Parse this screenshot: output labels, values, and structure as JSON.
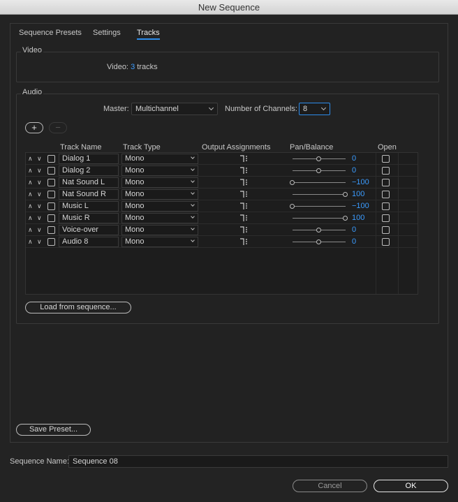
{
  "window": {
    "title": "New Sequence"
  },
  "tabs": [
    {
      "label": "Sequence Presets"
    },
    {
      "label": "Settings"
    },
    {
      "label": "Tracks"
    }
  ],
  "video": {
    "group_label": "Video",
    "label": "Video:",
    "count": "3",
    "unit": "tracks"
  },
  "audio": {
    "group_label": "Audio",
    "master_label": "Master:",
    "master_value": "Multichannel",
    "channels_label": "Number of Channels:",
    "channels_value": "8",
    "add_label": "+",
    "remove_label": "−",
    "columns": {
      "track_name": "Track Name",
      "track_type": "Track Type",
      "output": "Output Assignments",
      "pan": "Pan/Balance",
      "open": "Open"
    },
    "tracks": [
      {
        "name": "Dialog 1",
        "type": "Mono",
        "pan": "0",
        "pan_value": 0
      },
      {
        "name": "Dialog 2",
        "type": "Mono",
        "pan": "0",
        "pan_value": 0
      },
      {
        "name": "Nat Sound L",
        "type": "Mono",
        "pan": "−100",
        "pan_value": -100
      },
      {
        "name": "Nat Sound R",
        "type": "Mono",
        "pan": "100",
        "pan_value": 100
      },
      {
        "name": "Music L",
        "type": "Mono",
        "pan": "−100",
        "pan_value": -100
      },
      {
        "name": "Music R",
        "type": "Mono",
        "pan": "100",
        "pan_value": 100
      },
      {
        "name": "Voice-over",
        "type": "Mono",
        "pan": "0",
        "pan_value": 0
      },
      {
        "name": "Audio 8",
        "type": "Mono",
        "pan": "0",
        "pan_value": 0
      }
    ],
    "load_button": "Load from sequence..."
  },
  "save_preset_button": "Save Preset...",
  "sequence_name": {
    "label": "Sequence Name:",
    "value": "Sequence 08"
  },
  "buttons": {
    "cancel": "Cancel",
    "ok": "OK"
  },
  "colors": {
    "accent": "#3b9cff",
    "tab_underline": "#2d8ceb"
  },
  "icons": {
    "move": "chevron-up-down-icon",
    "output": "output-routing-icon"
  }
}
